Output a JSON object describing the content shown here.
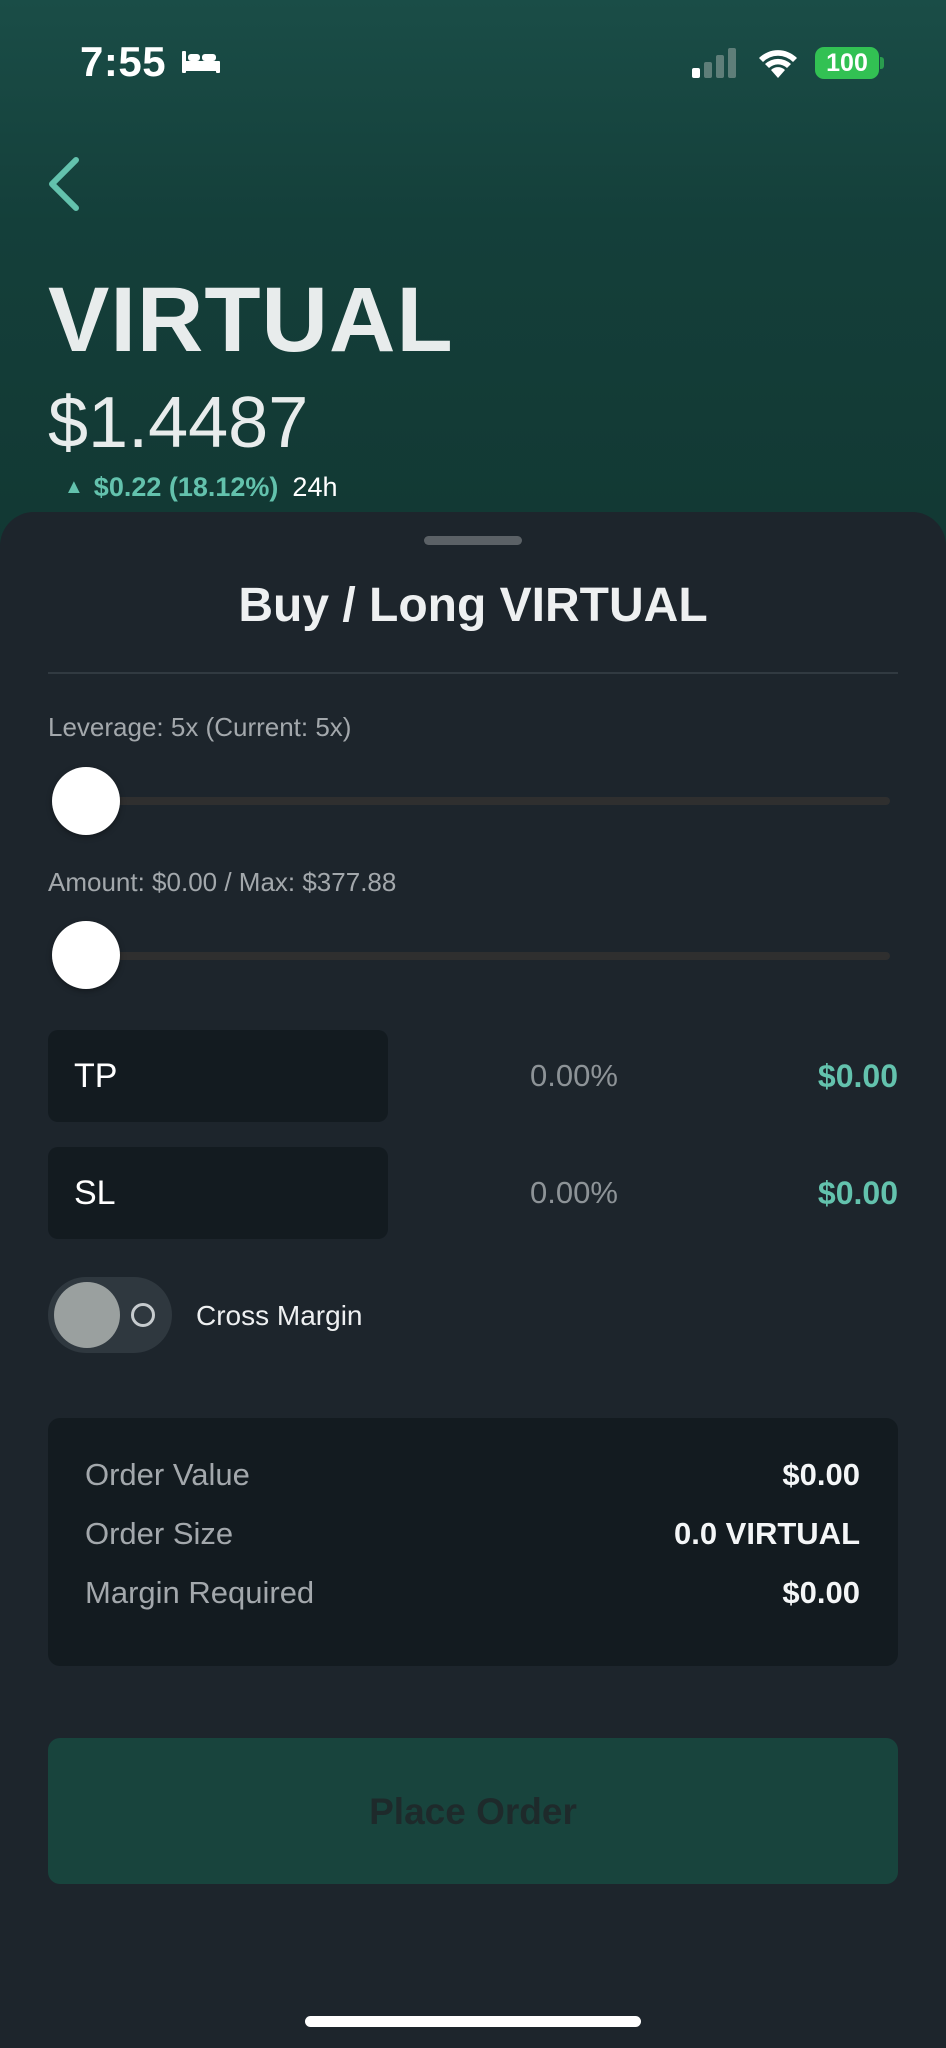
{
  "status_bar": {
    "time": "7:55",
    "battery": "100",
    "icons": [
      "bed-icon",
      "signal-icon",
      "wifi-icon",
      "battery-icon"
    ]
  },
  "asset": {
    "ticker": "VIRTUAL",
    "price": "$1.4487",
    "change": "$0.22 (18.12%)",
    "change_period": "24h",
    "change_direction": "up"
  },
  "sheet": {
    "title": "Buy / Long VIRTUAL",
    "leverage_label": "Leverage: 5x (Current: 5x)",
    "leverage_level": 0,
    "amount_label": "Amount: $0.00 / Max: $377.88",
    "amount_level": 0,
    "tp": {
      "label": "TP",
      "percent": "0.00%",
      "amount": "$0.00"
    },
    "sl": {
      "label": "SL",
      "percent": "0.00%",
      "amount": "$0.00"
    },
    "cross_margin": {
      "label": "Cross Margin",
      "enabled": false
    }
  },
  "summary": {
    "rows": [
      {
        "label": "Order Value",
        "value": "$0.00"
      },
      {
        "label": "Order Size",
        "value": "0.0 VIRTUAL"
      },
      {
        "label": "Margin Required",
        "value": "$0.00"
      }
    ]
  },
  "actions": {
    "place_order": "Place Order"
  },
  "colors": {
    "accent": "#63c2ad",
    "header_gradient_top": "#1a4d47",
    "sheet_bg": "#1d252c",
    "field_bg": "#131b20",
    "button_bg": "#18443d"
  }
}
